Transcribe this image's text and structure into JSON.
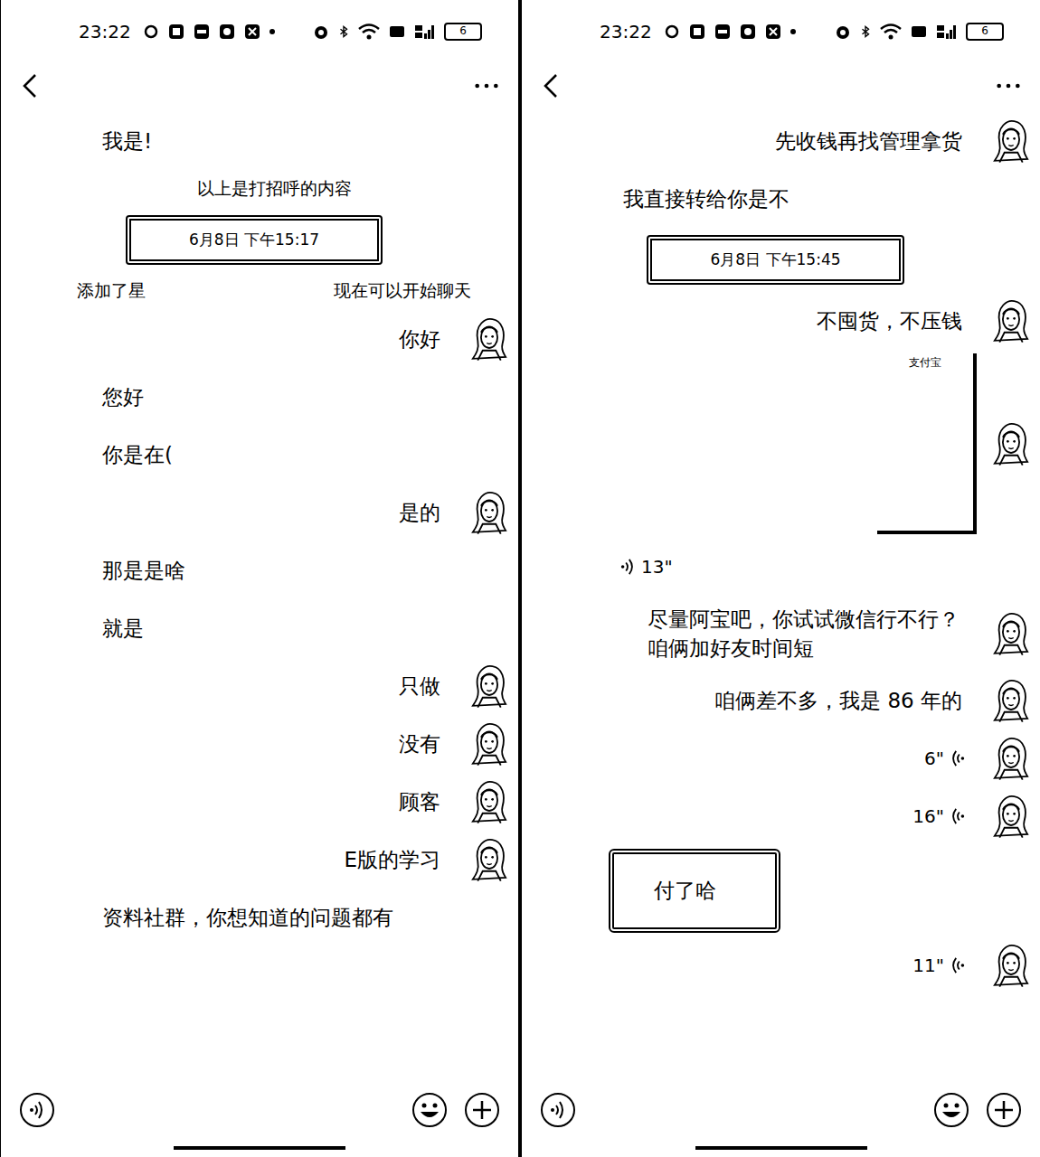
{
  "screens": [
    {
      "status_bar": {
        "time": "23:22",
        "battery": "6"
      },
      "messages": [
        {
          "kind": "text",
          "side": "left",
          "text": "我是!",
          "boxed": false
        },
        {
          "kind": "system",
          "parts": [
            "以上是打招呼的内容"
          ]
        },
        {
          "kind": "timestamp",
          "text": "6月8日 下午15:17"
        },
        {
          "kind": "system",
          "parts": [
            "添加了星",
            "现在可以开始聊天"
          ]
        },
        {
          "kind": "text",
          "side": "right",
          "text": "你好",
          "boxed": false
        },
        {
          "kind": "text",
          "side": "left",
          "text": "您好",
          "boxed": false
        },
        {
          "kind": "text",
          "side": "left",
          "text": "你是在(",
          "boxed": false
        },
        {
          "kind": "text",
          "side": "right",
          "text": "是的",
          "boxed": false
        },
        {
          "kind": "text",
          "side": "left",
          "text": "那是是啥",
          "boxed": false
        },
        {
          "kind": "text",
          "side": "left",
          "text": "就是",
          "boxed": false
        },
        {
          "kind": "text",
          "side": "right",
          "text": "只做",
          "boxed": false
        },
        {
          "kind": "text",
          "side": "right",
          "text": "没有",
          "boxed": false
        },
        {
          "kind": "text",
          "side": "right",
          "text": "顾客",
          "boxed": false
        },
        {
          "kind": "text",
          "side": "right",
          "text": "E版的学习",
          "boxed": false
        },
        {
          "kind": "text",
          "side": "left",
          "text": "资料社群，你想知道的问题都有",
          "boxed": false
        }
      ]
    },
    {
      "status_bar": {
        "time": "23:22",
        "battery": "6"
      },
      "messages": [
        {
          "kind": "text",
          "side": "right",
          "text": "先收钱再找管理拿货",
          "boxed": false
        },
        {
          "kind": "text",
          "side": "left",
          "text": "我直接转给你是不",
          "boxed": false
        },
        {
          "kind": "timestamp",
          "text": "6月8日 下午15:45"
        },
        {
          "kind": "text",
          "side": "right",
          "text": "不囤货，不压钱",
          "boxed": false
        },
        {
          "kind": "card",
          "side": "right",
          "text": "支付宝"
        },
        {
          "kind": "voice",
          "side": "left",
          "text": "13\""
        },
        {
          "kind": "text",
          "side": "right",
          "text": "尽量阿宝吧，你试试微信行不行？咱俩加好友时间短",
          "boxed": false
        },
        {
          "kind": "text",
          "side": "right",
          "text": "咱俩差不多，我是 86 年的",
          "boxed": false
        },
        {
          "kind": "voice",
          "side": "right",
          "text": "6\""
        },
        {
          "kind": "voice",
          "side": "right",
          "text": "16\""
        },
        {
          "kind": "text",
          "side": "left",
          "text": "付了哈",
          "boxed": true
        },
        {
          "kind": "voice",
          "side": "right",
          "text": "11\""
        }
      ]
    }
  ]
}
